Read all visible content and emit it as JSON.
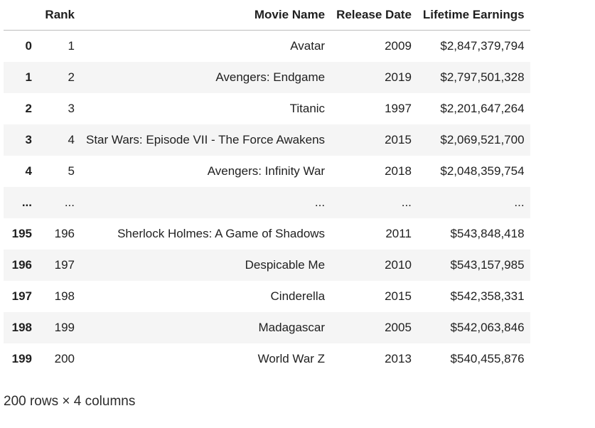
{
  "dataframe": {
    "columns": [
      "Rank",
      "Movie Name",
      "Release Date",
      "Lifetime Earnings"
    ],
    "rows": [
      {
        "index": "0",
        "rank": "1",
        "name": "Avatar",
        "date": "2009",
        "earnings": "$2,847,379,794"
      },
      {
        "index": "1",
        "rank": "2",
        "name": "Avengers: Endgame",
        "date": "2019",
        "earnings": "$2,797,501,328"
      },
      {
        "index": "2",
        "rank": "3",
        "name": "Titanic",
        "date": "1997",
        "earnings": "$2,201,647,264"
      },
      {
        "index": "3",
        "rank": "4",
        "name": "Star Wars: Episode VII - The Force Awakens",
        "date": "2015",
        "earnings": "$2,069,521,700"
      },
      {
        "index": "4",
        "rank": "5",
        "name": "Avengers: Infinity War",
        "date": "2018",
        "earnings": "$2,048,359,754"
      },
      {
        "index": "...",
        "rank": "...",
        "name": "...",
        "date": "...",
        "earnings": "..."
      },
      {
        "index": "195",
        "rank": "196",
        "name": "Sherlock Holmes: A Game of Shadows",
        "date": "2011",
        "earnings": "$543,848,418"
      },
      {
        "index": "196",
        "rank": "197",
        "name": "Despicable Me",
        "date": "2010",
        "earnings": "$543,157,985"
      },
      {
        "index": "197",
        "rank": "198",
        "name": "Cinderella",
        "date": "2015",
        "earnings": "$542,358,331"
      },
      {
        "index": "198",
        "rank": "199",
        "name": "Madagascar",
        "date": "2005",
        "earnings": "$542,063,846"
      },
      {
        "index": "199",
        "rank": "200",
        "name": "World War Z",
        "date": "2013",
        "earnings": "$540,455,876"
      }
    ],
    "shape_text": "200 rows × 4 columns"
  }
}
